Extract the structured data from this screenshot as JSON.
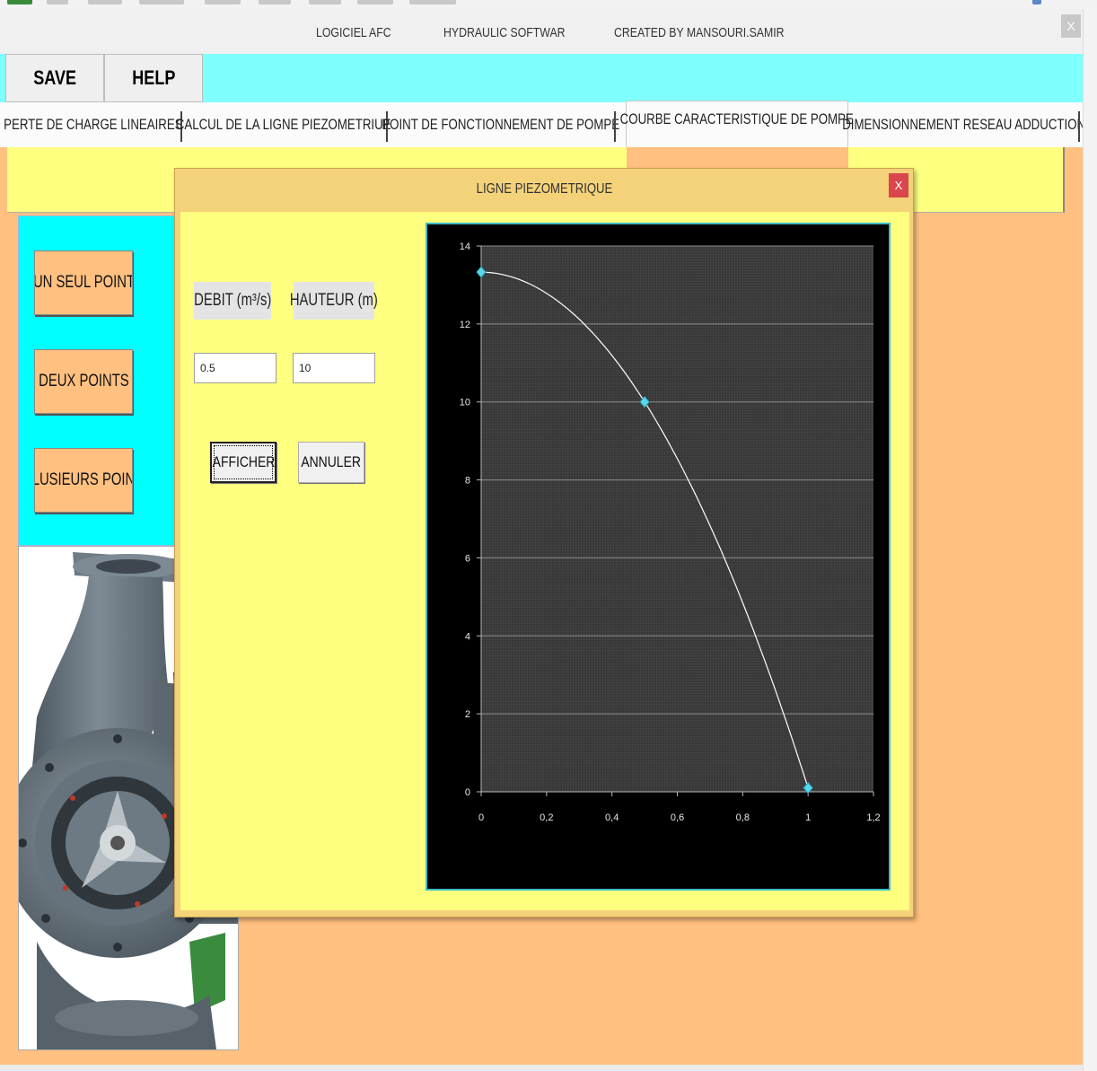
{
  "window": {
    "title_left": "LOGICIEL  AFC",
    "title_mid": "HYDRAULIC  SOFTWAR",
    "title_right": "CREATED  BY  MANSOURI.SAMIR",
    "close_label": "X"
  },
  "menu": {
    "save_label": "SAVE",
    "help_label": "HELP"
  },
  "tabs": [
    {
      "label": "PERTE DE CHARGE LINEAIRES"
    },
    {
      "label": "CALCUL DE LA LIGNE PIEZOMETRIUE"
    },
    {
      "label": "POINT DE FONCTIONNEMENT DE POMPE"
    },
    {
      "label": "COURBE CARACTERISTIQUE DE POMPE"
    },
    {
      "label": "DIMENSIONNEMENT RESEAU ADDUCTION"
    }
  ],
  "left_panel": {
    "buttons": [
      {
        "label": "UN SEUL POINT"
      },
      {
        "label": "DEUX POINTS"
      },
      {
        "label": "PLUSIEURS POINT"
      }
    ]
  },
  "dialog": {
    "title": "LIGNE  PIEZOMETRIQUE",
    "close_label": "X",
    "debit_label": "DEBIT  (m³/s)",
    "hauteur_label": "HAUTEUR (m)",
    "debit_value": "0.5",
    "hauteur_value": "10",
    "afficher_label": "AFFICHER",
    "annuler_label": "ANNULER"
  },
  "colors": {
    "title_bar": "#f0f0f0",
    "menu_bar": "#80ffff",
    "tab_page": "#ffc080",
    "panel_yellow": "#ffff80",
    "left_panel": "#00ffff",
    "dialog_frame": "#f4d27a",
    "chart_background": "#000000",
    "plot_area": "#3a3a3a",
    "curve": "#ffffff",
    "marker": "#5ad8ec"
  },
  "chart_data": {
    "type": "scatter",
    "title": "",
    "xlabel": "",
    "ylabel": "",
    "xlim": [
      0,
      1.2
    ],
    "ylim": [
      0,
      14
    ],
    "x_ticks": [
      "0",
      "0,2",
      "0,4",
      "0,6",
      "0,8",
      "1",
      "1,2"
    ],
    "y_ticks": [
      "0",
      "2",
      "4",
      "6",
      "8",
      "10",
      "12",
      "14"
    ],
    "grid": "horizontal",
    "smooth_line": true,
    "series": [
      {
        "points": [
          {
            "x": 0,
            "y": 13.33
          },
          {
            "x": 0.5,
            "y": 10
          },
          {
            "x": 1,
            "y": 0.1
          }
        ]
      }
    ]
  }
}
